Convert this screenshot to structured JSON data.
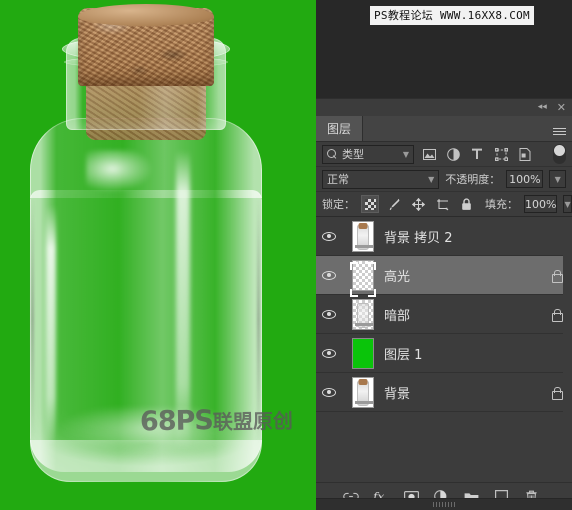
{
  "canvas": {
    "background_color": "#22aa11",
    "subject": "glass-jar-with-cork",
    "watermark": "68PS",
    "watermark_cn": "联盟原创"
  },
  "workspace": {
    "background_color": "#282828",
    "watermark": "PS教程论坛 WWW.16XX8.COM"
  },
  "panel": {
    "title_tab": "图层",
    "menu_icon": "hamburger-menu-icon",
    "collapse_icon": "double-chevron-left-icon",
    "close_icon": "close-icon",
    "filter": {
      "search_icon": "magnifier-icon",
      "type_label": "类型",
      "caret": "⌄",
      "icons": [
        "pixel-layer-filter-icon",
        "adjustment-layer-filter-icon",
        "type-layer-filter-icon",
        "shape-layer-filter-icon",
        "smart-object-filter-icon"
      ],
      "toggle_state": "on"
    },
    "blend": {
      "mode": "正常",
      "opacity_label": "不透明度：",
      "opacity_value": "100%",
      "caret": "⌄"
    },
    "lock": {
      "label": "锁定：",
      "buttons": [
        "lock-transparent-pixels-icon",
        "lock-image-pixels-icon",
        "lock-position-icon",
        "lock-artboard-icon",
        "lock-all-icon"
      ],
      "fill_label": "填充：",
      "fill_value": "100%",
      "caret": "⌄"
    },
    "layers": [
      {
        "name": "背景 拷贝 2",
        "visible": true,
        "locked": false,
        "selected": false,
        "thumb": "jar",
        "lock_icon": ""
      },
      {
        "name": "高光",
        "visible": true,
        "locked": true,
        "selected": true,
        "thumb": "transparent",
        "lock_icon": "padlock-icon"
      },
      {
        "name": "暗部",
        "visible": true,
        "locked": true,
        "selected": false,
        "thumb": "transparent-jar",
        "lock_icon": "padlock-icon"
      },
      {
        "name": "图层 1",
        "visible": true,
        "locked": false,
        "selected": false,
        "thumb": "green",
        "lock_icon": ""
      },
      {
        "name": "背景",
        "visible": true,
        "locked": true,
        "selected": false,
        "thumb": "jar",
        "lock_icon": "padlock-icon"
      }
    ],
    "bottom_toolbar": [
      "link-layers-icon",
      "layer-style-fx-icon",
      "add-layer-mask-icon",
      "new-adjustment-layer-icon",
      "new-group-icon",
      "new-layer-icon",
      "delete-layer-icon"
    ],
    "colors": {
      "panel_bg": "#3c3c3c",
      "selected_row": "#6d6d6d",
      "tab_active": "#535353",
      "text": "#e2e2e2",
      "green_layer": "#0ac40a"
    }
  }
}
